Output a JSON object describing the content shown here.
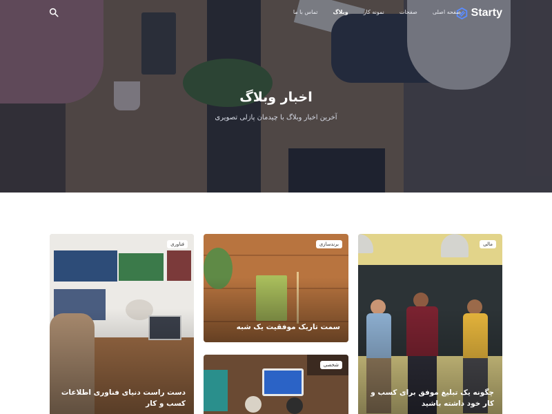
{
  "header": {
    "brand": "Starty",
    "menu": [
      {
        "label": "صفحه اصلی",
        "active": false
      },
      {
        "label": "صفحات",
        "active": false
      },
      {
        "label": "نمونه کار",
        "active": false
      },
      {
        "label": "وبلاگ",
        "active": true
      },
      {
        "label": "تماس با ما",
        "active": false
      }
    ]
  },
  "hero": {
    "title": "اخبار وبلاگ",
    "subtitle": "آخرین اخبار وبلاگ با چیدمان پازلی تصویری"
  },
  "posts": [
    {
      "category": "فناوری",
      "title": "دست راست دنیای فناوری اطلاعات کسب و کار"
    },
    {
      "category": "برندسازی",
      "title": "سمت تاریک موفقیت یک شبه"
    },
    {
      "category": "مالی",
      "title": "چگونه یک تبلیغ موفق برای کسب و کار خود داشته باشید"
    },
    {
      "category": "شخصی",
      "title": ""
    }
  ],
  "colors": {
    "hero_overlay": "#1e2438",
    "white": "#ffffff"
  },
  "icons": {
    "search": "search-icon",
    "logo": "logo-icon"
  }
}
